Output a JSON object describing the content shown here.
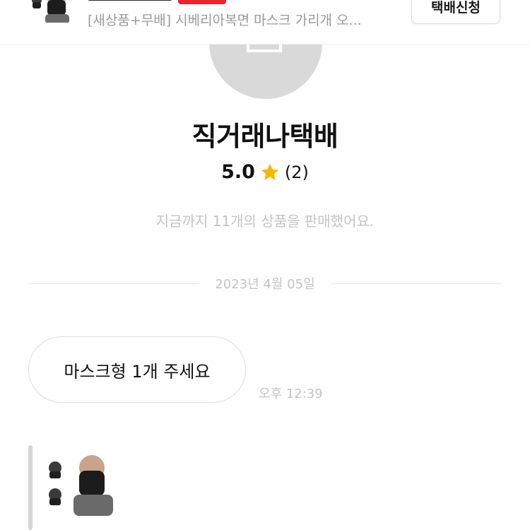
{
  "product_bar": {
    "title": "[새상품+무배] 시베리아복면 마스크 가리개 오...",
    "delivery_button_label": "택배신청",
    "thumbnail_icon": "balaclava-mask-image"
  },
  "seller": {
    "avatar_icon": "default-avatar-icon",
    "name": "직거래나택배",
    "rating": "5.0",
    "rating_icon": "star-icon",
    "review_count": "(2)",
    "sales_summary": "지금까지 11개의 상품을 판매했어요."
  },
  "chat": {
    "date": "2023년 4월 05일",
    "messages": [
      {
        "text": "마스크형 1개 주세요",
        "time": "오후 12:39"
      }
    ],
    "shared_card_icon": "balaclava-mask-image"
  },
  "colors": {
    "accent_red": "#e8262f",
    "star_yellow": "#f5b800",
    "muted_text": "#c4c4c4",
    "avatar_gray": "#d9d9d9"
  }
}
